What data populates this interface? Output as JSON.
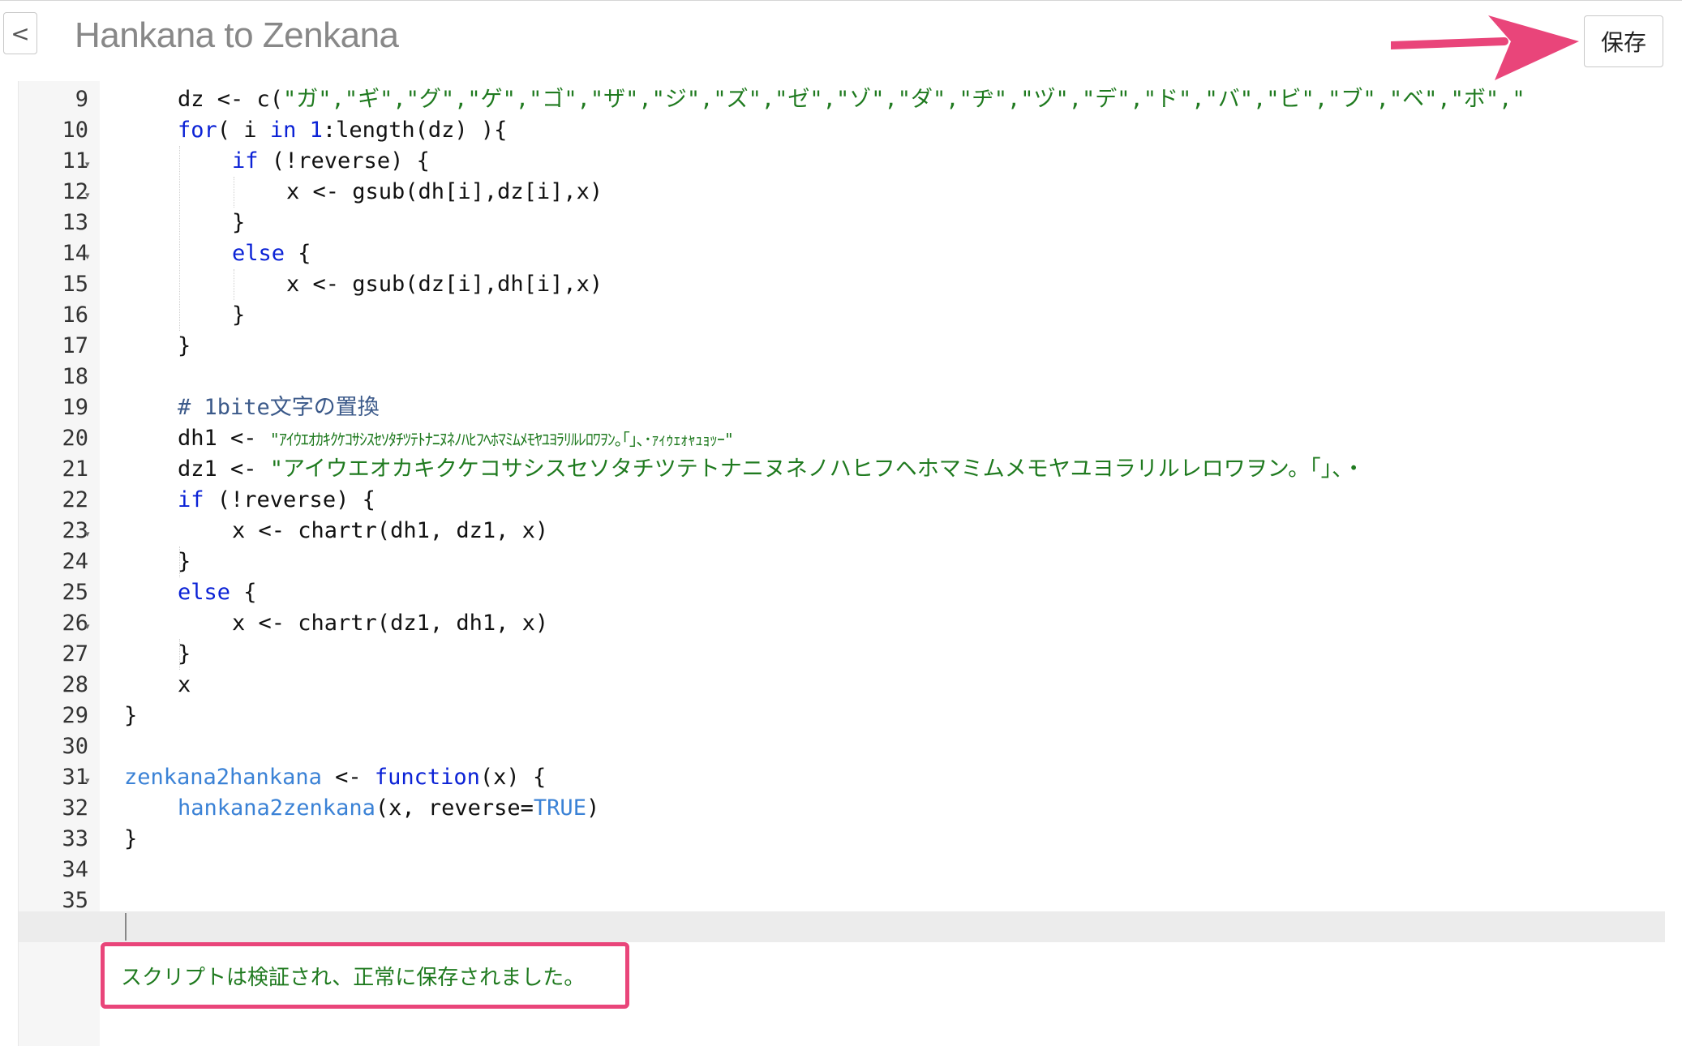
{
  "header": {
    "back_label": "<",
    "title": "Hankana to Zenkana",
    "save_label": "保存"
  },
  "colors": {
    "accent_highlight": "#e9457a",
    "keyword": "#0b22d6",
    "string": "#1f7a1f",
    "function_name": "#3b82d6"
  },
  "editor": {
    "line_numbers": [
      "9",
      "10",
      "11",
      "12",
      "13",
      "14",
      "15",
      "16",
      "17",
      "18",
      "19",
      "20",
      "21",
      "22",
      "23",
      "24",
      "25",
      "26",
      "27",
      "28",
      "29",
      "30",
      "31",
      "32",
      "33",
      "34",
      "35"
    ],
    "lines": {
      "l9_a": "dz <- c(",
      "l9_b": "\"ガ\",\"ギ\",\"グ\",\"ゲ\",\"ゴ\",\"ザ\",\"ジ\",\"ズ\",\"ゼ\",\"ゾ\",\"ダ\",\"ヂ\",\"ヅ\",\"デ\",\"ド\",\"バ\",\"ビ\",\"ブ\",\"ベ\",\"ボ\",\"",
      "l10_a": "for",
      "l10_b": "( i ",
      "l10_c": "in",
      "l10_d": " ",
      "l10_e": "1",
      "l10_f": ":length(dz) ){",
      "l11_a": "if",
      "l11_b": " (!reverse) {",
      "l12": "x <- gsub(dh[i],dz[i],x)",
      "l13": "}",
      "l14_a": "else",
      "l14_b": " {",
      "l15": "x <- gsub(dz[i],dh[i],x)",
      "l16": "}",
      "l17": "}",
      "l19": "# 1bite文字の置換",
      "l20_a": "dh1 <- ",
      "l20_b": "\"ｱｲｳｴｵｶｷｸｹｺｻｼｽｾｿﾀﾁﾂﾃﾄﾅﾆﾇﾈﾉﾊﾋﾌﾍﾎﾏﾐﾑﾒﾓﾔﾕﾖﾗﾘﾙﾚﾛﾜｦﾝ｡｢｣､･ｧｨｩｪｫｬｭｮｯｰ\"",
      "l21_a": "dz1 <- ",
      "l21_b": "\"アイウエオカキクケコサシスセソタチツテトナニヌネノハヒフヘホマミムメモヤユヨラリルレロワヲン。「」、・",
      "l22_a": "if",
      "l22_b": " (!reverse) {",
      "l23": "x <- chartr(dh1, dz1, x)",
      "l24": "}",
      "l25_a": "else",
      "l25_b": " {",
      "l26": "x <- chartr(dz1, dh1, x)",
      "l27": "}",
      "l28": "x",
      "l29": "}",
      "l31_a": "zenkana2hankana",
      "l31_b": " <- ",
      "l31_c": "function",
      "l31_d": "(x) {",
      "l32_a": "hankana2zenkana",
      "l32_b": "(x, reverse=",
      "l32_c": "TRUE",
      "l32_d": ")",
      "l33": "}"
    }
  },
  "status": {
    "message": "スクリプトは検証され、正常に保存されました。"
  }
}
